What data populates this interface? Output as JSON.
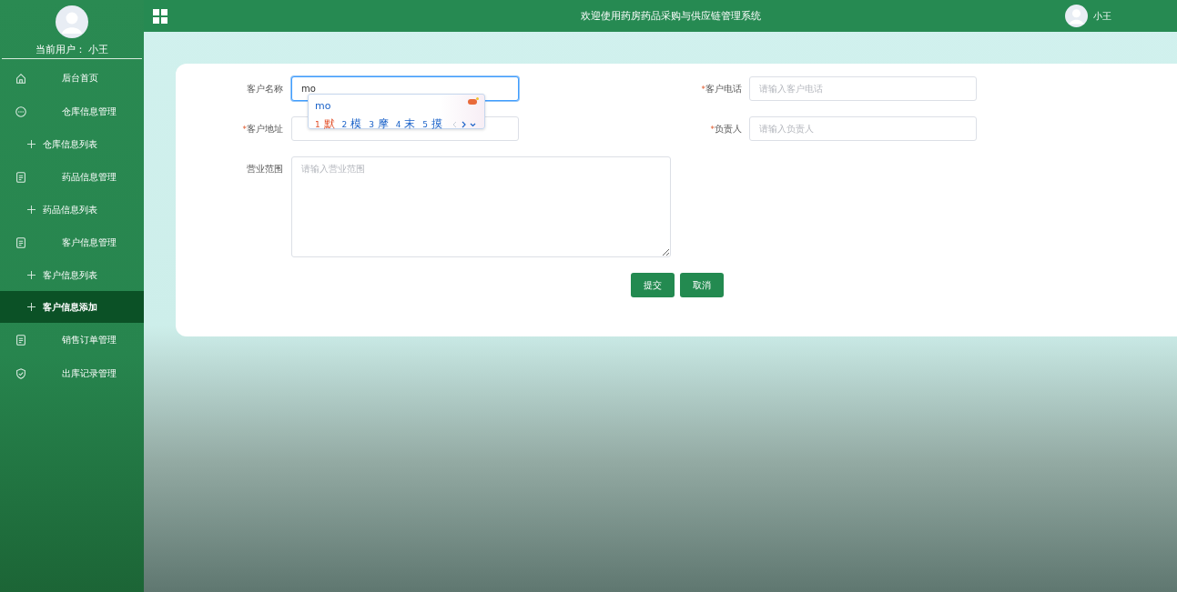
{
  "sidebar": {
    "user_label": "当前用户： 小王",
    "items": [
      {
        "label": "后台首页",
        "kind": "home",
        "selected": false
      },
      {
        "label": "仓库信息管理",
        "kind": "chat",
        "selected": false
      },
      {
        "label": "仓库信息列表",
        "kind": "sub",
        "selected": false
      },
      {
        "label": "药品信息管理",
        "kind": "doc",
        "selected": false
      },
      {
        "label": "药品信息列表",
        "kind": "sub",
        "selected": false
      },
      {
        "label": "客户信息管理",
        "kind": "doc",
        "selected": false
      },
      {
        "label": "客户信息列表",
        "kind": "sub",
        "selected": false
      },
      {
        "label": "客户信息添加",
        "kind": "sub",
        "selected": true
      },
      {
        "label": "销售订单管理",
        "kind": "doc",
        "selected": false
      },
      {
        "label": "出库记录管理",
        "kind": "shield",
        "selected": false
      }
    ]
  },
  "header": {
    "title": "欢迎使用药房药品采购与供应链管理系统",
    "user_name": "小王"
  },
  "form": {
    "fields": [
      {
        "label": "客户名称",
        "value": "mo",
        "focused": true
      },
      {
        "label": "客户电话",
        "required_mark": "*",
        "placeholder": "请输入客户电话",
        "focused": false
      },
      {
        "label": "客户地址",
        "required_mark": "*",
        "focused": false
      },
      {
        "label": "负责人",
        "required_mark": "*",
        "placeholder": "请输入负责人",
        "focused": false
      },
      {
        "label": "营业范围",
        "placeholder": "请输入营业范围",
        "kind": "textarea"
      }
    ],
    "buttons": [
      "提交",
      "取消"
    ]
  },
  "ime": {
    "input": "mo",
    "candidates": [
      {
        "number": "1",
        "text": "默",
        "selected": true
      },
      {
        "number": "2",
        "text": "模",
        "selected": false
      },
      {
        "number": "3",
        "text": "摩",
        "selected": false
      },
      {
        "number": "4",
        "text": "末",
        "selected": false
      },
      {
        "number": "5",
        "text": "摸",
        "selected": false
      }
    ]
  }
}
